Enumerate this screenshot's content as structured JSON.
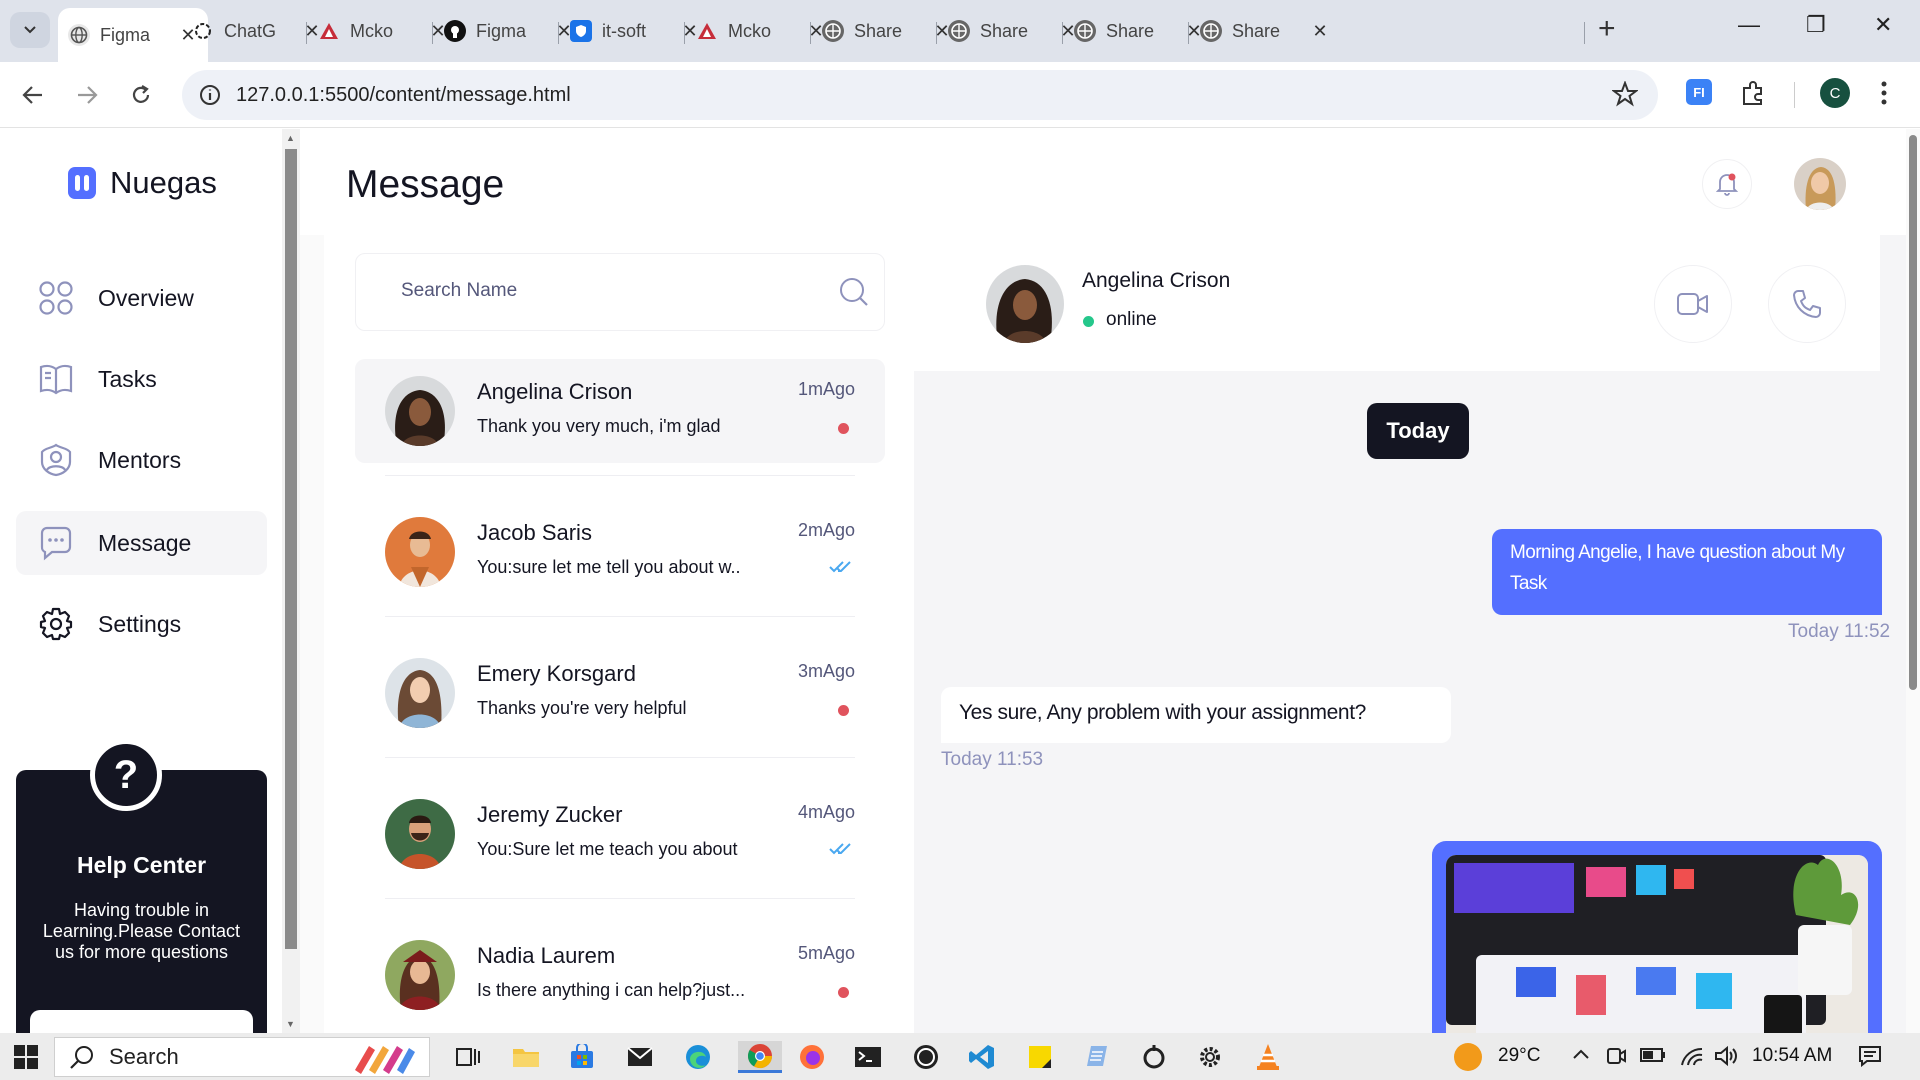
{
  "browser": {
    "tabs": [
      {
        "title": "Figma",
        "active": true
      },
      {
        "title": "ChatG"
      },
      {
        "title": "Mcko"
      },
      {
        "title": "Figma"
      },
      {
        "title": "it-soft"
      },
      {
        "title": "Mcko"
      },
      {
        "title": "Share"
      },
      {
        "title": "Share"
      },
      {
        "title": "Share"
      },
      {
        "title": "Share"
      }
    ],
    "url": "127.0.0.1:5500/content/message.html",
    "profile_initial": "C",
    "extension_label": "FI"
  },
  "sidebar": {
    "brand": "Nuegas",
    "items": [
      {
        "label": "Overview",
        "icon": "grid-icon"
      },
      {
        "label": "Tasks",
        "icon": "book-icon"
      },
      {
        "label": "Mentors",
        "icon": "user-circle-icon"
      },
      {
        "label": "Message",
        "icon": "chat-bubble-icon",
        "active": true
      },
      {
        "label": "Settings",
        "icon": "gear-icon"
      }
    ],
    "help": {
      "icon_glyph": "?",
      "title": "Help Center",
      "text": "Having trouble in Learning.Please Contact us for more questions"
    }
  },
  "header": {
    "title": "Message"
  },
  "chatlist": {
    "search_placeholder": "Search Name",
    "conversations": [
      {
        "name": "Angelina Crison",
        "message": "Thank you very much, i'm glad",
        "time": "1mAgo",
        "indicator": "unread-dot",
        "selected": true
      },
      {
        "name": "Jacob Saris",
        "message": "You:sure let me tell you about w..",
        "time": "2mAgo",
        "indicator": "read-checks"
      },
      {
        "name": "Emery Korsgard",
        "message": "Thanks you're very helpful",
        "time": "3mAgo",
        "indicator": "unread-dot"
      },
      {
        "name": "Jeremy Zucker",
        "message": "You:Sure let me teach you about",
        "time": "4mAgo",
        "indicator": "read-checks"
      },
      {
        "name": "Nadia Laurem",
        "message": "Is there anything i can help?just...",
        "time": "5mAgo",
        "indicator": "unread-dot"
      }
    ]
  },
  "chat": {
    "contact_name": "Angelina Crison",
    "status": "online",
    "day_label": "Today",
    "messages": [
      {
        "direction": "out",
        "text": "Morning Angelie, I have question about My Task",
        "time": "Today 11:52"
      },
      {
        "direction": "in",
        "text": "Yes sure, Any problem with your assignment?",
        "time": "Today 11:53"
      }
    ]
  },
  "taskbar": {
    "search_label": "Search",
    "weather": "29°C",
    "clock": "10:54 AM"
  },
  "colors": {
    "accent": "#546fff",
    "dark": "#141522",
    "online": "#25c78b",
    "unread": "#e0535d",
    "muted": "#8e92bc"
  }
}
